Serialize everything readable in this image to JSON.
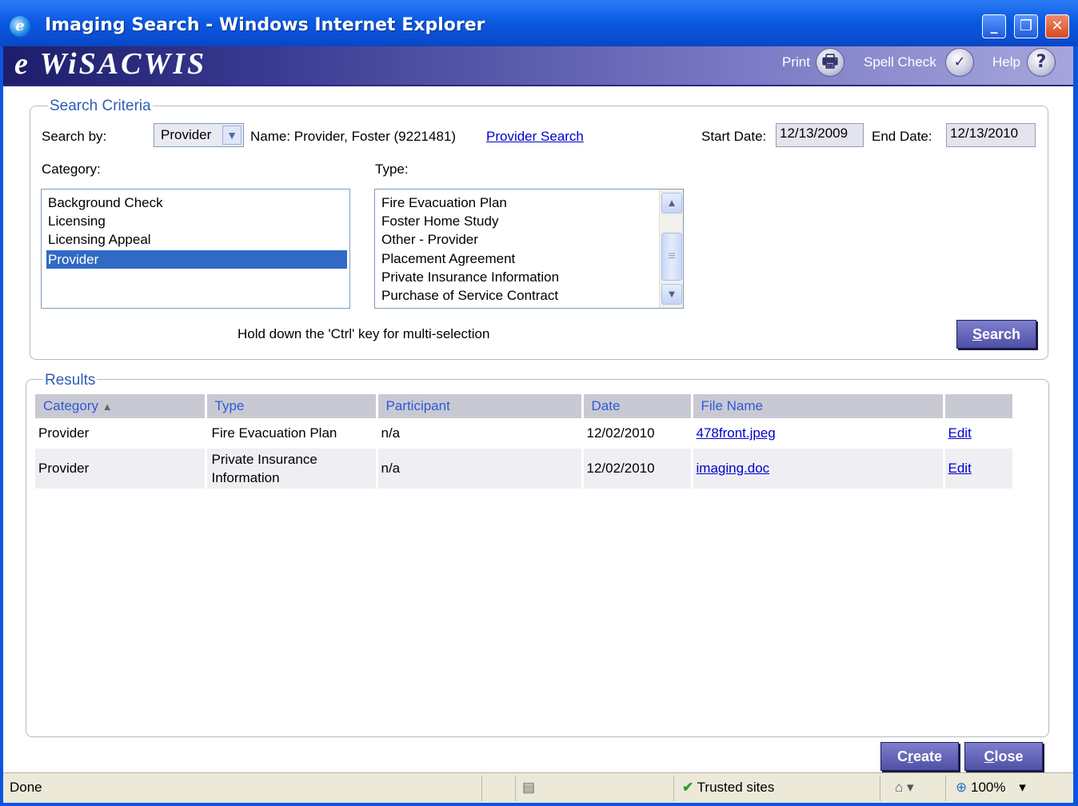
{
  "window": {
    "title": "Imaging Search - Windows Internet Explorer",
    "icon": "ie-icon",
    "controls": {
      "minimize": "_",
      "restore": "❐",
      "close": "✕"
    }
  },
  "header": {
    "brand": "e WiSACWIS",
    "print_label": "Print",
    "spell_check_label": "Spell Check",
    "help_label": "Help",
    "help_glyph": "?"
  },
  "search_criteria": {
    "legend": "Search Criteria",
    "search_by_label": "Search by:",
    "search_by_value": "Provider",
    "name_text": "Name: Provider, Foster (9221481)",
    "provider_search_link": "Provider Search",
    "start_date_label": "Start Date:",
    "start_date_value": "12/13/2009",
    "end_date_label": "End Date:",
    "end_date_value": "12/13/2010",
    "category_label": "Category:",
    "type_label": "Type:",
    "categories": [
      {
        "label": "Background Check",
        "selected": false
      },
      {
        "label": "Licensing",
        "selected": false
      },
      {
        "label": "Licensing Appeal",
        "selected": false
      },
      {
        "label": "Provider",
        "selected": true
      }
    ],
    "types": [
      "Fire Evacuation Plan",
      "Foster Home Study",
      "Other - Provider",
      "Placement Agreement",
      "Private Insurance Information",
      "Purchase of Service Contract"
    ],
    "hint": "Hold down the 'Ctrl' key for multi-selection",
    "search_button": "Search"
  },
  "results": {
    "legend": "Results",
    "columns": [
      "Category",
      "Type",
      "Participant",
      "Date",
      "File Name",
      ""
    ],
    "sort_indicator": "▲",
    "rows": [
      {
        "category": "Provider",
        "type": "Fire Evacuation Plan",
        "participant": "n/a",
        "date": "12/02/2010",
        "file_name": "478front.jpeg",
        "action": "Edit"
      },
      {
        "category": "Provider",
        "type_line1": "Private Insurance",
        "type_line2": "Information",
        "participant": "n/a",
        "date": "12/02/2010",
        "file_name": "imaging.doc",
        "action": "Edit"
      }
    ]
  },
  "footer_buttons": {
    "create": "Create",
    "close": "Close"
  },
  "statusbar": {
    "status": "Done",
    "zone": "Trusted sites",
    "zoom": "100%"
  }
}
